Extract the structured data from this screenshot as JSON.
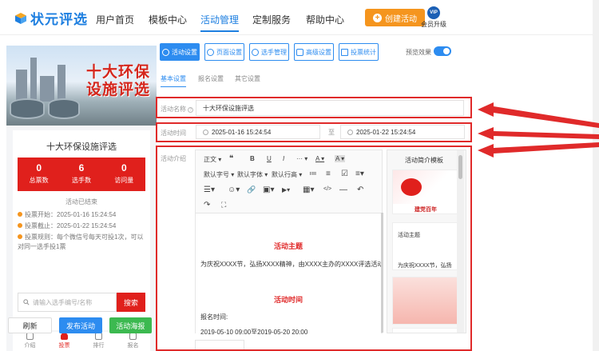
{
  "brand": {
    "name": "状元评选"
  },
  "nav": {
    "items": [
      "用户首页",
      "模板中心",
      "活动管理",
      "定制服务",
      "帮助中心"
    ],
    "create_label": "创建活动",
    "vip_badge": "VIP",
    "vip_label": "会员升级"
  },
  "preview": {
    "banner_title_line1": "十大环保",
    "banner_title_line2": "设施评选",
    "activity_title": "十大环保设施评选",
    "stats": [
      {
        "value": "0",
        "label": "总票数"
      },
      {
        "value": "6",
        "label": "选手数"
      },
      {
        "value": "0",
        "label": "访问量"
      }
    ],
    "ended_text": "活动已结束",
    "vote_start": "投票开始：2025-01-16 15:24:54",
    "vote_end": "投票截止：2025-01-22 15:24:54",
    "vote_rule": "投票规则：每个微信号每天可投1次，可以对同一选手投1票",
    "search_placeholder": "请输入选手编号/名称",
    "search_button": "搜索",
    "tabbar": [
      "介绍",
      "投票",
      "排行",
      "报名"
    ],
    "actions": {
      "refresh": "刷新",
      "publish": "发布活动",
      "poster": "活动海报"
    }
  },
  "toolbar": {
    "buttons": [
      "活动设置",
      "页面设置",
      "选手管理",
      "高级设置",
      "投票统计"
    ],
    "preview_label": "预览效果"
  },
  "subtabs": [
    "基本设置",
    "报名设置",
    "其它设置"
  ],
  "form": {
    "name_label": "活动名称",
    "name_value": "十大环保设施评选",
    "time_label": "活动时间",
    "time_start": "2025-01-16 15:24:54",
    "time_to": "至",
    "time_end": "2025-01-22 15:24:54",
    "intro_label": "活动介绍"
  },
  "editor": {
    "toolbar_row1": [
      "正文",
      "❝",
      "B",
      "U",
      "I",
      "···",
      "A",
      "A"
    ],
    "toolbar_row2": [
      "默认字号",
      "默认字体",
      "默认行高",
      "≔",
      "≡",
      "☑",
      "≡"
    ],
    "toolbar_row3": [
      "☰",
      "☺",
      "🔗",
      "▣",
      "▶",
      "▦",
      "</>",
      "—",
      "↶"
    ],
    "toolbar_row4": [
      "↷",
      "⛶"
    ],
    "content": {
      "heading1": "活动主题",
      "para1": "为庆祝XXXX节，弘扬XXXX精神，由XXXX主办的XXXX评选活动。",
      "heading2": "活动时间",
      "para2": "报名时间:",
      "para3": "2019-05-10 09:00至2019-05-20 20:00"
    }
  },
  "templates": {
    "title": "活动简介模板",
    "card1_caption": "建党百年",
    "card2_caption": "活动主题",
    "card2_sub": "为庆祝XXXX节，弘扬"
  },
  "colors": {
    "accent": "#2d8cf0",
    "brand": "#1e7fe0",
    "highlight_red": "#e02a2a",
    "create": "#f5951e"
  }
}
